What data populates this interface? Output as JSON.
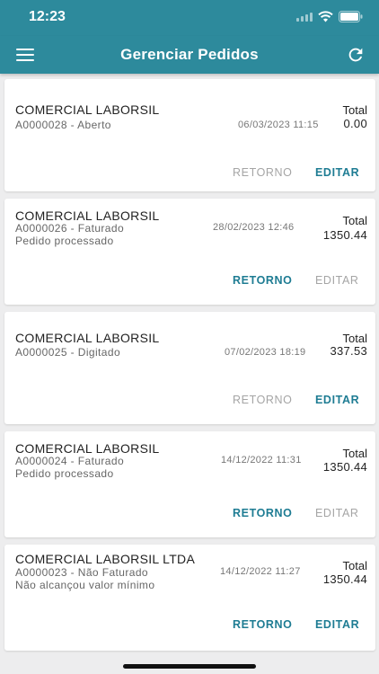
{
  "status_bar": {
    "time": "12:23"
  },
  "header": {
    "title": "Gerenciar Pedidos"
  },
  "orders": [
    {
      "client": "COMERCIAL LABORSIL",
      "order": "A0000028 - Aberto",
      "note": "",
      "date": "06/03/2023 11:15",
      "total_label": "Total",
      "total": "0.00",
      "return_label": "RETORNO",
      "edit_label": "EDITAR",
      "return_enabled": false,
      "edit_enabled": true
    },
    {
      "client": "COMERCIAL LABORSIL",
      "order": "A0000026 - Faturado",
      "note": "Pedido processado",
      "date": "28/02/2023 12:46",
      "total_label": "Total",
      "total": "1350.44",
      "return_label": "RETORNO",
      "edit_label": "EDITAR",
      "return_enabled": true,
      "edit_enabled": false
    },
    {
      "client": "COMERCIAL LABORSIL",
      "order": "A0000025 - Digitado",
      "note": "",
      "date": "07/02/2023 18:19",
      "total_label": "Total",
      "total": "337.53",
      "return_label": "RETORNO",
      "edit_label": "EDITAR",
      "return_enabled": false,
      "edit_enabled": true
    },
    {
      "client": "COMERCIAL LABORSIL",
      "order": "A0000024 - Faturado",
      "note": "Pedido processado",
      "date": "14/12/2022 11:31",
      "total_label": "Total",
      "total": "1350.44",
      "return_label": "RETORNO",
      "edit_label": "EDITAR",
      "return_enabled": true,
      "edit_enabled": false
    },
    {
      "client": "COMERCIAL LABORSIL LTDA",
      "order": "A0000023 - Não Faturado",
      "note": "Não alcançou valor mínimo",
      "date": "14/12/2022 11:27",
      "total_label": "Total",
      "total": "1350.44",
      "return_label": "RETORNO",
      "edit_label": "EDITAR",
      "return_enabled": true,
      "edit_enabled": true
    }
  ],
  "colors": {
    "primary": "#2d8a9c",
    "action": "#1e7c93",
    "disabled": "#a5a5a5"
  }
}
